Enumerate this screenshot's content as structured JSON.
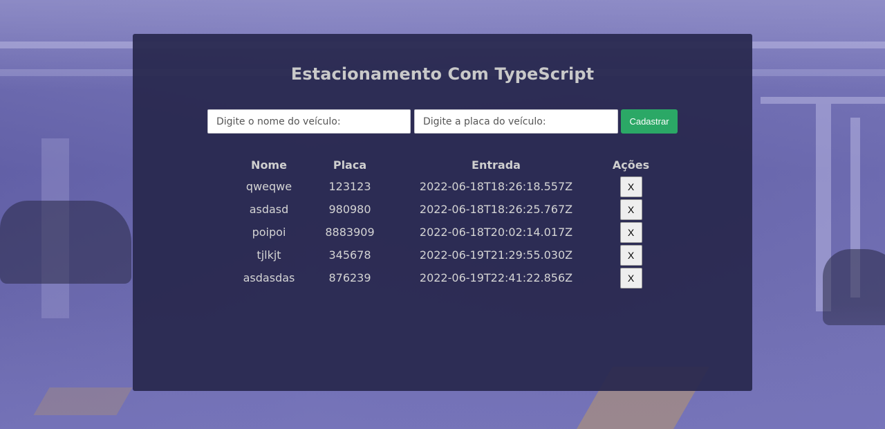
{
  "app": {
    "title": "Estacionamento Com TypeScript"
  },
  "form": {
    "nome_placeholder": "Digite o nome do veículo:",
    "nome_value": "",
    "placa_placeholder": "Digite a placa do veículo:",
    "placa_value": "",
    "submit_label": "Cadastrar"
  },
  "table": {
    "headers": {
      "nome": "Nome",
      "placa": "Placa",
      "entrada": "Entrada",
      "acoes": "Ações"
    },
    "rows": [
      {
        "nome": "qweqwe",
        "placa": "123123",
        "entrada": "2022-06-18T18:26:18.557Z",
        "remove_label": "X"
      },
      {
        "nome": "asdasd",
        "placa": "980980",
        "entrada": "2022-06-18T18:26:25.767Z",
        "remove_label": "X"
      },
      {
        "nome": "poipoi",
        "placa": "8883909",
        "entrada": "2022-06-18T20:02:14.017Z",
        "remove_label": "X"
      },
      {
        "nome": "tjlkjt",
        "placa": "345678",
        "entrada": "2022-06-19T21:29:55.030Z",
        "remove_label": "X"
      },
      {
        "nome": "asdasdas",
        "placa": "876239",
        "entrada": "2022-06-19T22:41:22.856Z",
        "remove_label": "X"
      }
    ]
  },
  "colors": {
    "panel": "#28284e",
    "accent": "#2ba866",
    "text": "#d4d4d4"
  }
}
